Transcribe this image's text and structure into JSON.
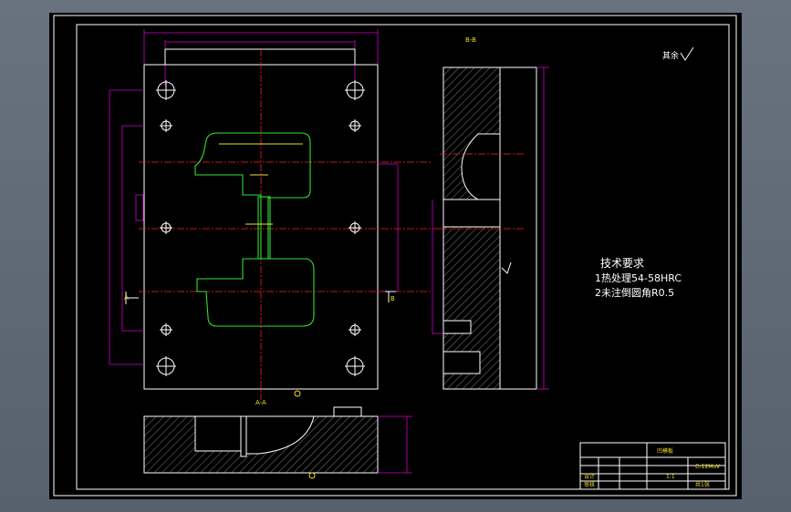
{
  "drawing": {
    "surface_roughness_note": "其余",
    "tech_requirements": {
      "title": "技术要求",
      "line1": "1热处理54-58HRC",
      "line2": "2未注倒圆角R0.5"
    },
    "section_labels": {
      "top_view_a": "A",
      "top_view_b": "B",
      "side_section": "B-B",
      "bottom_section": "A-A"
    },
    "title_block": {
      "part_name": "凹模板",
      "material": "Cr12MoV",
      "scale": "1:1",
      "sheet": "共1张",
      "designer_label": "设计",
      "checker_label": "审核"
    }
  },
  "colors": {
    "background": "#000000",
    "frame": "#ffffff",
    "dimension": "#d000d0",
    "centerline": "#ff2020",
    "cavity": "#30e030",
    "text_annotation": "#f0e020"
  }
}
